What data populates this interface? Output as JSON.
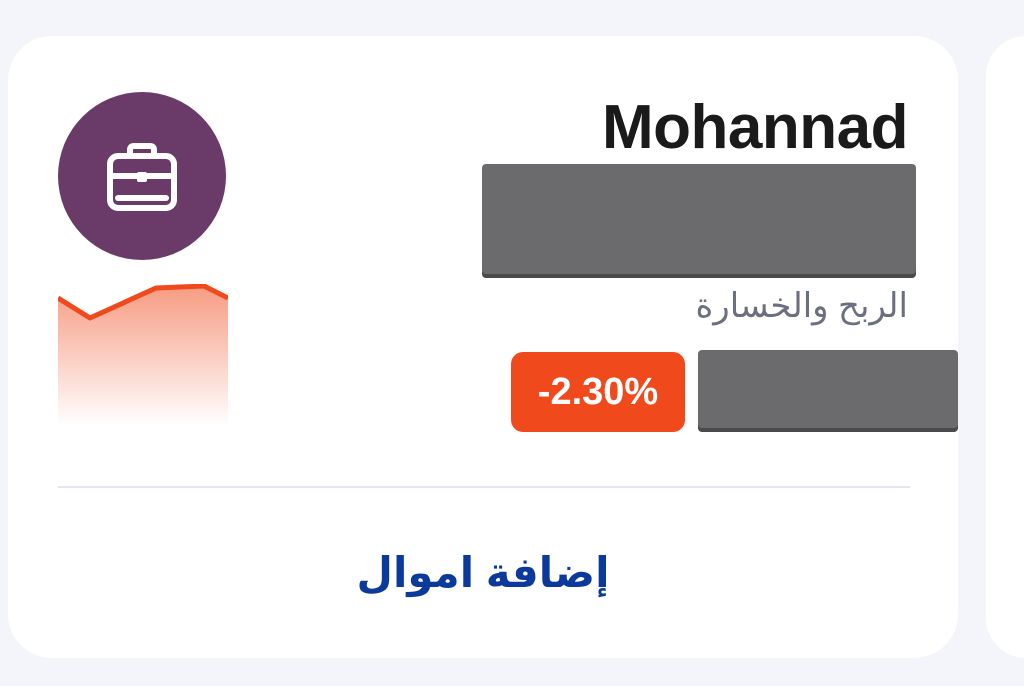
{
  "account": {
    "name": "Mohannad",
    "icon": "briefcase-icon",
    "avatar_color": "#6a3a68"
  },
  "pnl": {
    "label": "الربح والخسارة",
    "percent": "-2.30%",
    "badge_color": "#f04a1c"
  },
  "actions": {
    "add_funds": "إضافة اموال"
  },
  "sparkline": {
    "trend": "negative",
    "color": "#f04a1c"
  }
}
